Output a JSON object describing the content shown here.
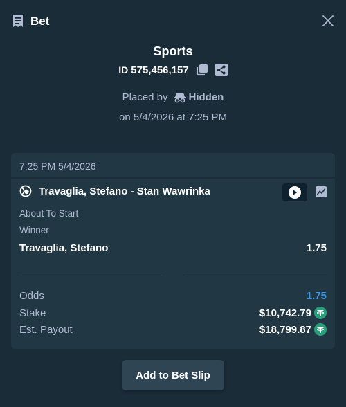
{
  "header": {
    "title": "Bet"
  },
  "bet": {
    "sport": "Sports",
    "id_label": "ID",
    "id_number": "575,456,157",
    "placed_by_label": "Placed by",
    "placed_by_user": "Hidden",
    "placed_on": "on 5/4/2026 at 7:25 PM"
  },
  "card": {
    "timestamp": "7:25 PM 5/4/2026",
    "match": "Travaglia, Stefano - Stan Wawrinka",
    "status": "About To Start",
    "market": "Winner",
    "selection": "Travaglia, Stefano",
    "selection_odds": "1.75",
    "odds_label": "Odds",
    "odds_value": "1.75",
    "stake_label": "Stake",
    "stake_value": "$10,742.79",
    "payout_label": "Est. Payout",
    "payout_value": "$18,799.87"
  },
  "actions": {
    "add_to_slip": "Add to Bet Slip"
  },
  "colors": {
    "background": "#1a2c38",
    "card": "#213743",
    "muted_text": "#b1bad3",
    "odds_blue": "#3d96e8",
    "tether_green": "#26a17b"
  },
  "icons": {
    "bet": "bet-slip-icon",
    "close": "close-icon",
    "copy": "copy-icon",
    "share": "share-icon",
    "hidden": "incognito-icon",
    "sport": "tennis-ball-icon",
    "live": "play-icon",
    "stats": "stats-chart-icon",
    "currency": "tether-icon"
  }
}
